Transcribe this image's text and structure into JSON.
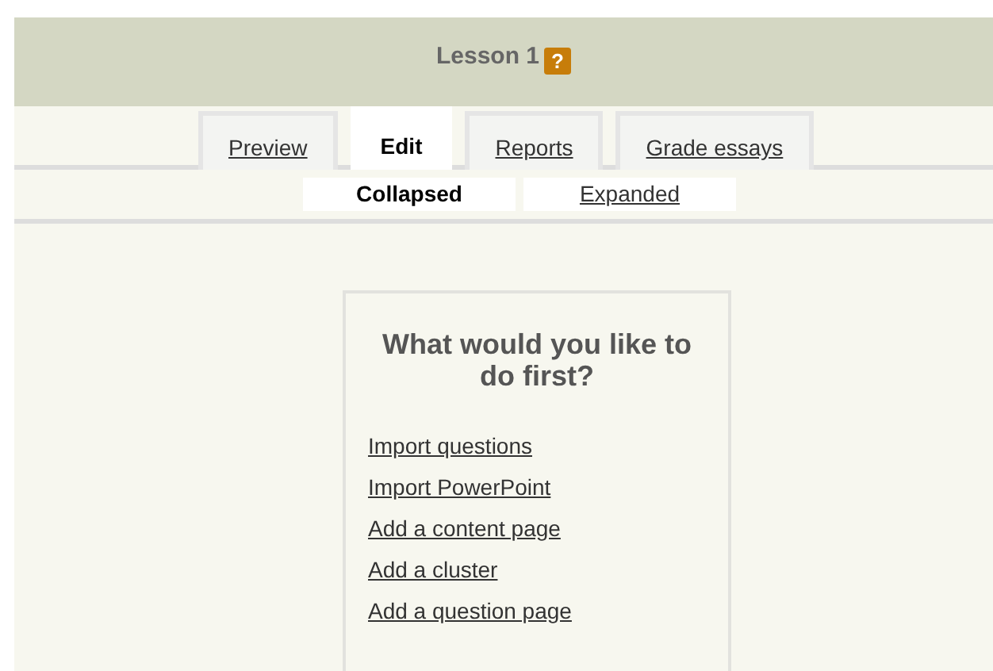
{
  "header": {
    "title": "Lesson 1",
    "help_icon": "?"
  },
  "tabs": [
    {
      "label": "Preview",
      "selected": false
    },
    {
      "label": "Edit",
      "selected": true
    },
    {
      "label": "Reports",
      "selected": false
    },
    {
      "label": "Grade essays",
      "selected": false
    }
  ],
  "view_modes": [
    {
      "label": "Collapsed",
      "selected": true
    },
    {
      "label": "Expanded",
      "selected": false
    }
  ],
  "panel": {
    "heading": "What would you like to do first?",
    "links": [
      "Import questions",
      "Import PowerPoint",
      "Add a content page",
      "Add a cluster",
      "Add a question page"
    ]
  }
}
